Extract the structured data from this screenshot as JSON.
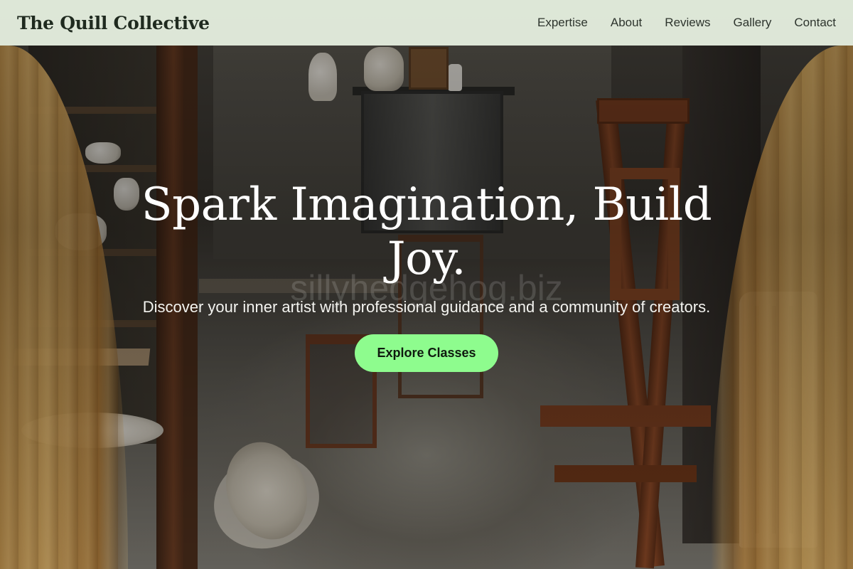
{
  "header": {
    "brand": "The Quill Collective",
    "nav": [
      {
        "label": "Expertise"
      },
      {
        "label": "About"
      },
      {
        "label": "Reviews"
      },
      {
        "label": "Gallery"
      },
      {
        "label": "Contact"
      }
    ]
  },
  "hero": {
    "title": "Spark Imagination, Build Joy.",
    "subtitle": "Discover your inner artist with professional guidance and a community of creators.",
    "cta_label": "Explore Classes",
    "watermark": "sillyhedgehog.biz",
    "image_description": "art studio interior with wooden easels, shelves of pottery and golden curtains"
  },
  "colors": {
    "nav_background": "#e8f2e2",
    "cta_background": "#8efc8e",
    "title_text": "#ffffff"
  }
}
